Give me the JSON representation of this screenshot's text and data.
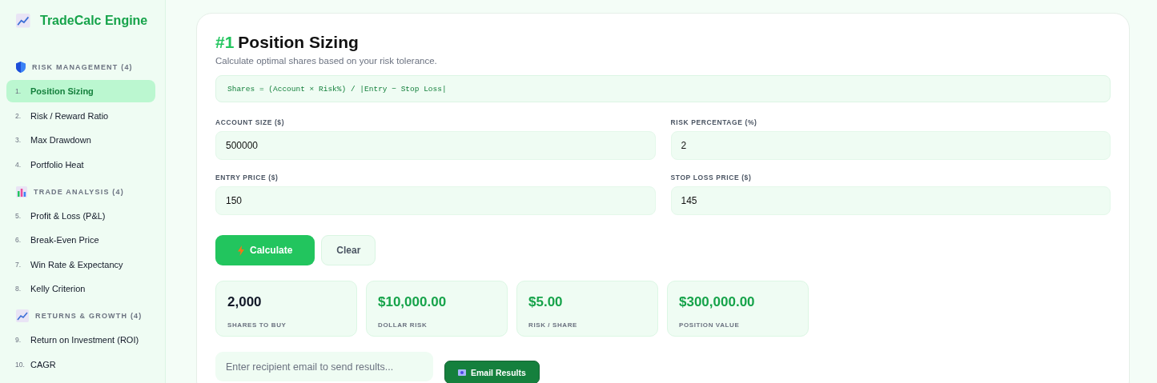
{
  "app": {
    "title": "TradeCalc Engine"
  },
  "sidebar": {
    "sections": [
      {
        "title": "RISK MANAGEMENT (4)",
        "items": [
          {
            "number": "1.",
            "label": "Position Sizing",
            "selected": true
          },
          {
            "number": "2.",
            "label": "Risk / Reward Ratio",
            "selected": false
          },
          {
            "number": "3.",
            "label": "Max Drawdown",
            "selected": false
          },
          {
            "number": "4.",
            "label": "Portfolio Heat",
            "selected": false
          }
        ]
      },
      {
        "title": "TRADE ANALYSIS (4)",
        "items": [
          {
            "number": "5.",
            "label": "Profit & Loss (P&L)",
            "selected": false
          },
          {
            "number": "6.",
            "label": "Break-Even Price",
            "selected": false
          },
          {
            "number": "7.",
            "label": "Win Rate & Expectancy",
            "selected": false
          },
          {
            "number": "8.",
            "label": "Kelly Criterion",
            "selected": false
          }
        ]
      },
      {
        "title": "RETURNS & GROWTH (4)",
        "items": [
          {
            "number": "9.",
            "label": "Return on Investment (ROI)",
            "selected": false
          },
          {
            "number": "10.",
            "label": "CAGR",
            "selected": false
          }
        ]
      }
    ]
  },
  "calculator": {
    "number": "#1",
    "title": "Position Sizing",
    "description": "Calculate optimal shares based on your risk tolerance.",
    "formula": "Shares = (Account × Risk%) / |Entry − Stop Loss|",
    "fields": [
      {
        "label": "ACCOUNT SIZE ($)",
        "value": "500000"
      },
      {
        "label": "RISK PERCENTAGE (%)",
        "value": "2"
      },
      {
        "label": "ENTRY PRICE ($)",
        "value": "150"
      },
      {
        "label": "STOP LOSS PRICE ($)",
        "value": "145"
      }
    ],
    "buttons": [
      {
        "label": "Calculate",
        "kind": "primary"
      },
      {
        "label": "Clear",
        "kind": "secondary"
      }
    ],
    "results": [
      {
        "value": "2,000",
        "label": "SHARES TO BUY",
        "color": "#111827"
      },
      {
        "value": "$10,000.00",
        "label": "DOLLAR RISK",
        "color": "#16a34a"
      },
      {
        "value": "$5.00",
        "label": "RISK / SHARE",
        "color": "#16a34a"
      },
      {
        "value": "$300,000.00",
        "label": "POSITION VALUE",
        "color": "#16a34a"
      }
    ],
    "email": {
      "placeholder": "Enter recipient email to send results...",
      "button": "Email Results"
    }
  }
}
